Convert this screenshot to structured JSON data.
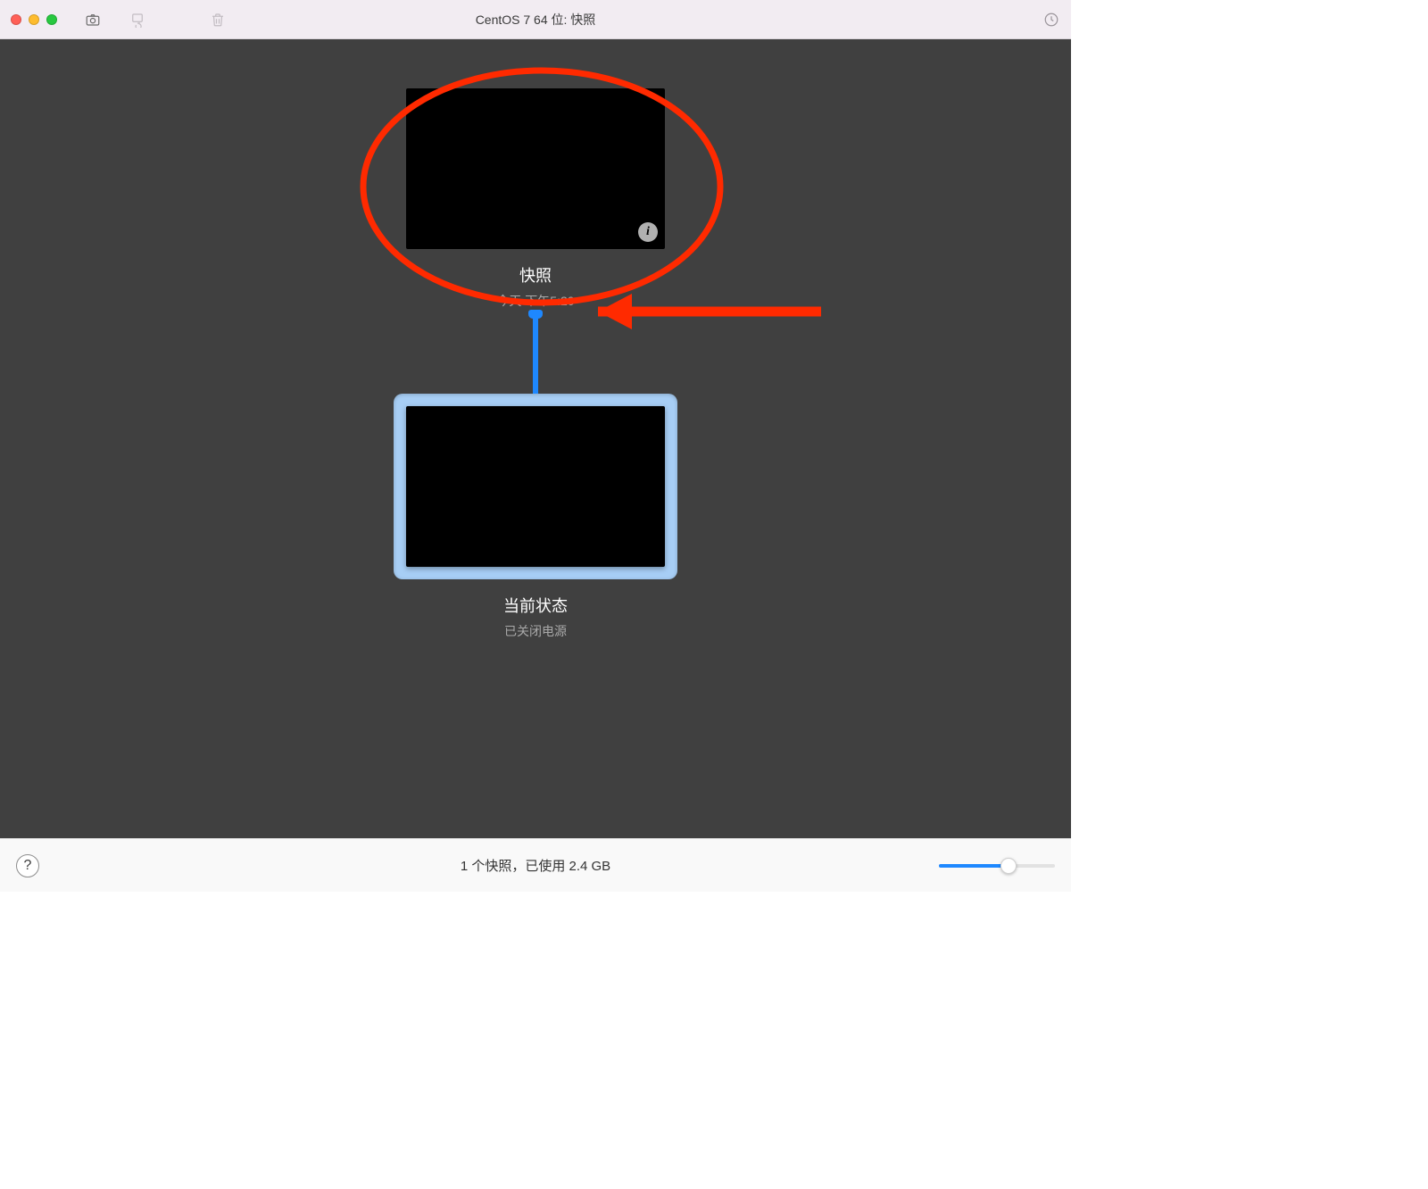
{
  "window": {
    "title": "CentOS 7 64 位: 快照"
  },
  "toolbar": {
    "take_snapshot_icon": "camera-icon",
    "revert_icon": "revert-icon",
    "delete_icon": "trash-icon",
    "autoprotect_icon": "clock-icon"
  },
  "snapshots": [
    {
      "title": "快照",
      "subtitle": "今天 下午5:20",
      "info_glyph": "i",
      "selected": false
    }
  ],
  "current": {
    "title": "当前状态",
    "subtitle": "已关闭电源",
    "selected": true
  },
  "statusbar": {
    "help_glyph": "?",
    "summary": "1 个快照，已使用 2.4 GB"
  },
  "annotation": {
    "color": "#ff2a00"
  }
}
